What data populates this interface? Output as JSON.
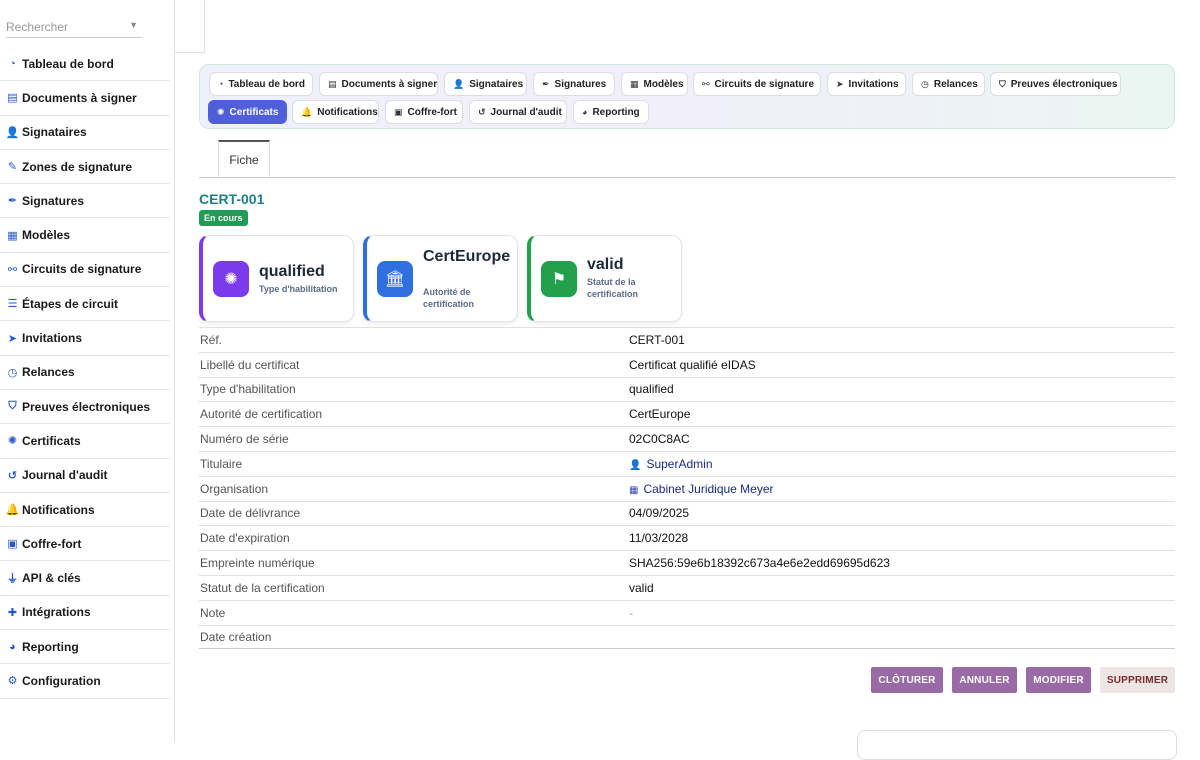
{
  "sidebar": {
    "search_placeholder": "Rechercher",
    "items": [
      {
        "label": "Tableau de bord",
        "icon": "dashboard-icon",
        "glyph": "◔"
      },
      {
        "label": "Documents à signer",
        "icon": "document-icon",
        "glyph": "▤"
      },
      {
        "label": "Signataires",
        "icon": "users-icon",
        "glyph": "👤"
      },
      {
        "label": "Zones de signature",
        "icon": "pen-icon",
        "glyph": "✎"
      },
      {
        "label": "Signatures",
        "icon": "signature-icon",
        "glyph": "✒"
      },
      {
        "label": "Modèles",
        "icon": "templates-icon",
        "glyph": "▦"
      },
      {
        "label": "Circuits de signature",
        "icon": "workflow-icon",
        "glyph": "⚯"
      },
      {
        "label": "Étapes de circuit",
        "icon": "list-icon",
        "glyph": "☰"
      },
      {
        "label": "Invitations",
        "icon": "paper-plane-icon",
        "glyph": "➤"
      },
      {
        "label": "Relances",
        "icon": "clock-icon",
        "glyph": "◷"
      },
      {
        "label": "Preuves électroniques",
        "icon": "shield-icon",
        "glyph": "⛉"
      },
      {
        "label": "Certificats",
        "icon": "certificate-icon",
        "glyph": "✺"
      },
      {
        "label": "Journal d'audit",
        "icon": "history-icon",
        "glyph": "↺"
      },
      {
        "label": "Notifications",
        "icon": "bell-icon",
        "glyph": "🔔"
      },
      {
        "label": "Coffre-fort",
        "icon": "archive-icon",
        "glyph": "▣"
      },
      {
        "label": "API & clés",
        "icon": "plug-icon",
        "glyph": "⏚"
      },
      {
        "label": "Intégrations",
        "icon": "puzzle-icon",
        "glyph": "✚"
      },
      {
        "label": "Reporting",
        "icon": "chart-pie-icon",
        "glyph": "◕"
      },
      {
        "label": "Configuration",
        "icon": "gear-icon",
        "glyph": "⚙"
      }
    ]
  },
  "tabs": [
    {
      "label": "Tableau de bord",
      "icon": "dashboard-icon",
      "glyph": "◔"
    },
    {
      "label": "Documents à signer",
      "icon": "document-icon",
      "glyph": "▤"
    },
    {
      "label": "Signataires",
      "icon": "users-icon",
      "glyph": "👤"
    },
    {
      "label": "Signatures",
      "icon": "signature-icon",
      "glyph": "✒"
    },
    {
      "label": "Modèles",
      "icon": "templates-icon",
      "glyph": "▦"
    },
    {
      "label": "Circuits de signature",
      "icon": "workflow-icon",
      "glyph": "⚯"
    },
    {
      "label": "Invitations",
      "icon": "paper-plane-icon",
      "glyph": "➤"
    },
    {
      "label": "Relances",
      "icon": "clock-icon",
      "glyph": "◷"
    },
    {
      "label": "Preuves électroniques",
      "icon": "shield-icon",
      "glyph": "⛉"
    },
    {
      "label": "Certificats",
      "icon": "certificate-icon",
      "glyph": "✺",
      "active": true
    },
    {
      "label": "Notifications",
      "icon": "bell-icon",
      "glyph": "🔔"
    },
    {
      "label": "Coffre-fort",
      "icon": "archive-icon",
      "glyph": "▣"
    },
    {
      "label": "Journal d'audit",
      "icon": "history-icon",
      "glyph": "↺"
    },
    {
      "label": "Reporting",
      "icon": "chart-pie-icon",
      "glyph": "◕"
    }
  ],
  "subtab": "Fiche",
  "record": {
    "title": "CERT-001",
    "status": "En cours"
  },
  "cards": [
    {
      "value": "qualified",
      "label": "Type d'habilitation",
      "icon": "certificate-icon",
      "glyph": "✺",
      "color": "#7c3aed"
    },
    {
      "value": "CertEurope",
      "label": "Autorité de certification",
      "icon": "institution-icon",
      "glyph": "🏛",
      "color": "#2f6fe0"
    },
    {
      "value": "valid",
      "label": "Statut de la certification",
      "icon": "flag-icon",
      "glyph": "⚑",
      "color": "#22a04b"
    }
  ],
  "fields": [
    {
      "key": "Réf.",
      "value": "CERT-001"
    },
    {
      "key": "Libellé du certificat",
      "value": "Certificat qualifié eIDAS"
    },
    {
      "key": "Type d'habilitation",
      "value": "qualified"
    },
    {
      "key": "Autorité de certification",
      "value": "CertEurope"
    },
    {
      "key": "Numéro de série",
      "value": "02C0C8AC"
    },
    {
      "key": "Titulaire",
      "value": "SuperAdmin",
      "link": true,
      "icon": "user-icon",
      "glyph": "👤"
    },
    {
      "key": "Organisation",
      "value": "Cabinet Juridique Meyer",
      "link": true,
      "icon": "building-icon",
      "glyph": "▦"
    },
    {
      "key": "Date de délivrance",
      "value": "04/09/2025"
    },
    {
      "key": "Date d'expiration",
      "value": "11/03/2028"
    },
    {
      "key": "Empreinte numérique",
      "value": "SHA256:59e6b18392c673a4e6e2edd69695d623"
    },
    {
      "key": "Statut de la certification",
      "value": "valid"
    },
    {
      "key": "Note",
      "value": "-",
      "muted": true
    },
    {
      "key": "Date création",
      "value": ""
    }
  ],
  "actions": {
    "close": "CLÔTURER",
    "cancel": "ANNULER",
    "edit": "MODIFIER",
    "delete": "SUPPRIMER"
  },
  "colors": {
    "primary_tab": "#4f5fd9",
    "title_teal": "#1e7f86",
    "status_green": "#1f9d57",
    "action_purple": "#9a6aa6",
    "link": "#1a2a8a"
  }
}
